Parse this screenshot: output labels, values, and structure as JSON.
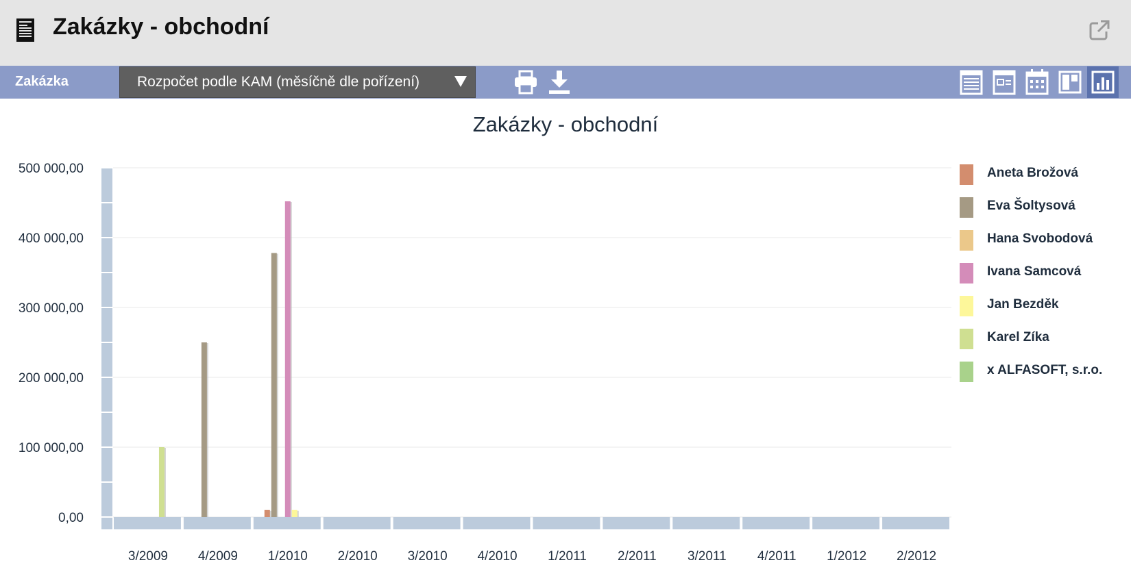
{
  "window": {
    "title": "Zakázky - obchodní"
  },
  "toolbar": {
    "label": "Zakázka",
    "report_select": {
      "selected": "Rozpočet podle KAM (měsíčně dle pořízení)"
    }
  },
  "icons": {
    "title": "document-icon",
    "external": "external-link-icon",
    "print": "print-icon",
    "download": "download-icon",
    "views": [
      "table-view-icon",
      "form-view-icon",
      "calendar-view-icon",
      "split-view-icon",
      "chart-view-icon"
    ]
  },
  "colors": {
    "toolbar": "#8b9bc8",
    "axis": "#bccbdc",
    "active_view": "#5b72ad"
  },
  "chart_data": {
    "type": "bar",
    "title": "Zakázky - obchodní",
    "xlabel": "",
    "ylabel": "",
    "ylim": [
      0,
      500000
    ],
    "y_ticks": [
      "0,00",
      "100 000,00",
      "200 000,00",
      "300 000,00",
      "400 000,00",
      "500 000,00"
    ],
    "categories": [
      "3/2009",
      "4/2009",
      "1/2010",
      "2/2010",
      "3/2010",
      "4/2010",
      "1/2011",
      "2/2011",
      "3/2011",
      "4/2011",
      "1/2012",
      "2/2012"
    ],
    "grid": true,
    "legend_position": "right",
    "series": [
      {
        "name": "Aneta Brožová",
        "color": "#d38d6e",
        "values": [
          0,
          0,
          10000,
          0,
          0,
          0,
          0,
          0,
          0,
          0,
          0,
          0
        ]
      },
      {
        "name": "Eva Šoltysová",
        "color": "#a59a84",
        "values": [
          0,
          250000,
          378000,
          0,
          0,
          0,
          0,
          0,
          0,
          0,
          0,
          0
        ]
      },
      {
        "name": "Hana Svobodová",
        "color": "#ebc88a",
        "values": [
          0,
          0,
          0,
          0,
          0,
          0,
          0,
          0,
          0,
          0,
          0,
          0
        ]
      },
      {
        "name": "Ivana Samcová",
        "color": "#d48cb9",
        "values": [
          0,
          0,
          452000,
          0,
          0,
          0,
          0,
          0,
          0,
          0,
          0,
          0
        ]
      },
      {
        "name": "Jan Bezděk",
        "color": "#fdf79a",
        "values": [
          0,
          0,
          10000,
          0,
          0,
          0,
          0,
          0,
          0,
          0,
          0,
          0
        ]
      },
      {
        "name": "Karel Zíka",
        "color": "#cfdf91",
        "values": [
          100000,
          0,
          0,
          0,
          0,
          0,
          0,
          0,
          0,
          0,
          0,
          0
        ]
      },
      {
        "name": "x ALFASOFT, s.r.o.",
        "color": "#a9d28b",
        "values": [
          0,
          0,
          0,
          0,
          0,
          0,
          0,
          0,
          0,
          0,
          0,
          0
        ]
      }
    ]
  }
}
